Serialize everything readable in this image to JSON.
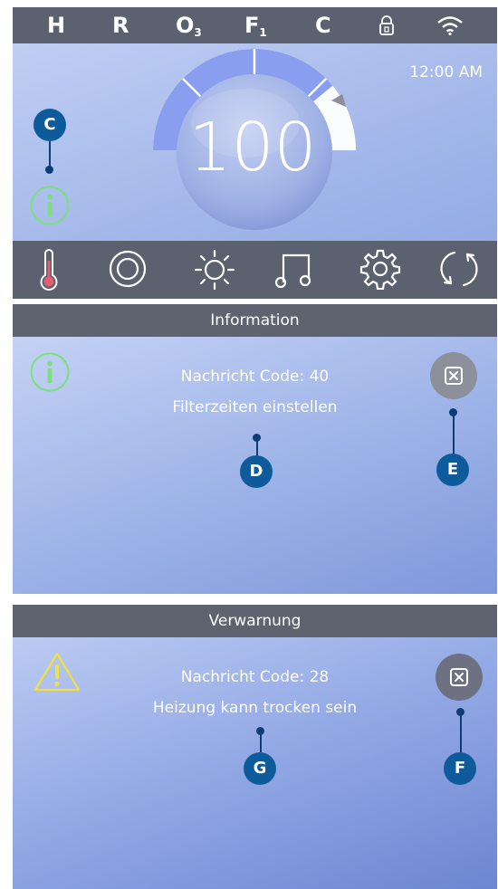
{
  "status_bar": {
    "items": [
      {
        "label": "H"
      },
      {
        "label": "R"
      },
      {
        "label": "O",
        "sub": "3"
      },
      {
        "label": "F",
        "sub": "1"
      },
      {
        "label": "C"
      }
    ],
    "icons": [
      "lock-icon",
      "wifi-icon"
    ]
  },
  "main": {
    "time": "12:00 AM",
    "temperature": "100",
    "gauge_level": 0.78
  },
  "bottom_bar": {
    "icons": [
      "thermometer-icon",
      "jets-icon",
      "light-icon",
      "music-icon",
      "settings-icon",
      "refresh-icon"
    ]
  },
  "info_dialog": {
    "title": "Information",
    "line1": "Nachricht Code: 40",
    "line2": "Filterzeiten einstellen",
    "close_icon": "close-icon"
  },
  "warn_dialog": {
    "title": "Verwarnung",
    "line1": "Nachricht Code: 28",
    "line2": "Heizung kann trocken sein",
    "close_icon": "close-icon"
  },
  "callouts": {
    "c": "C",
    "d": "D",
    "e": "E",
    "f": "F",
    "g": "G"
  },
  "colors": {
    "bar": "#5c6170",
    "gauge_fill": "#8a9ef0",
    "info_green": "#7be07b",
    "warn_yellow": "#f0e040",
    "callout": "#0d5b9a"
  }
}
